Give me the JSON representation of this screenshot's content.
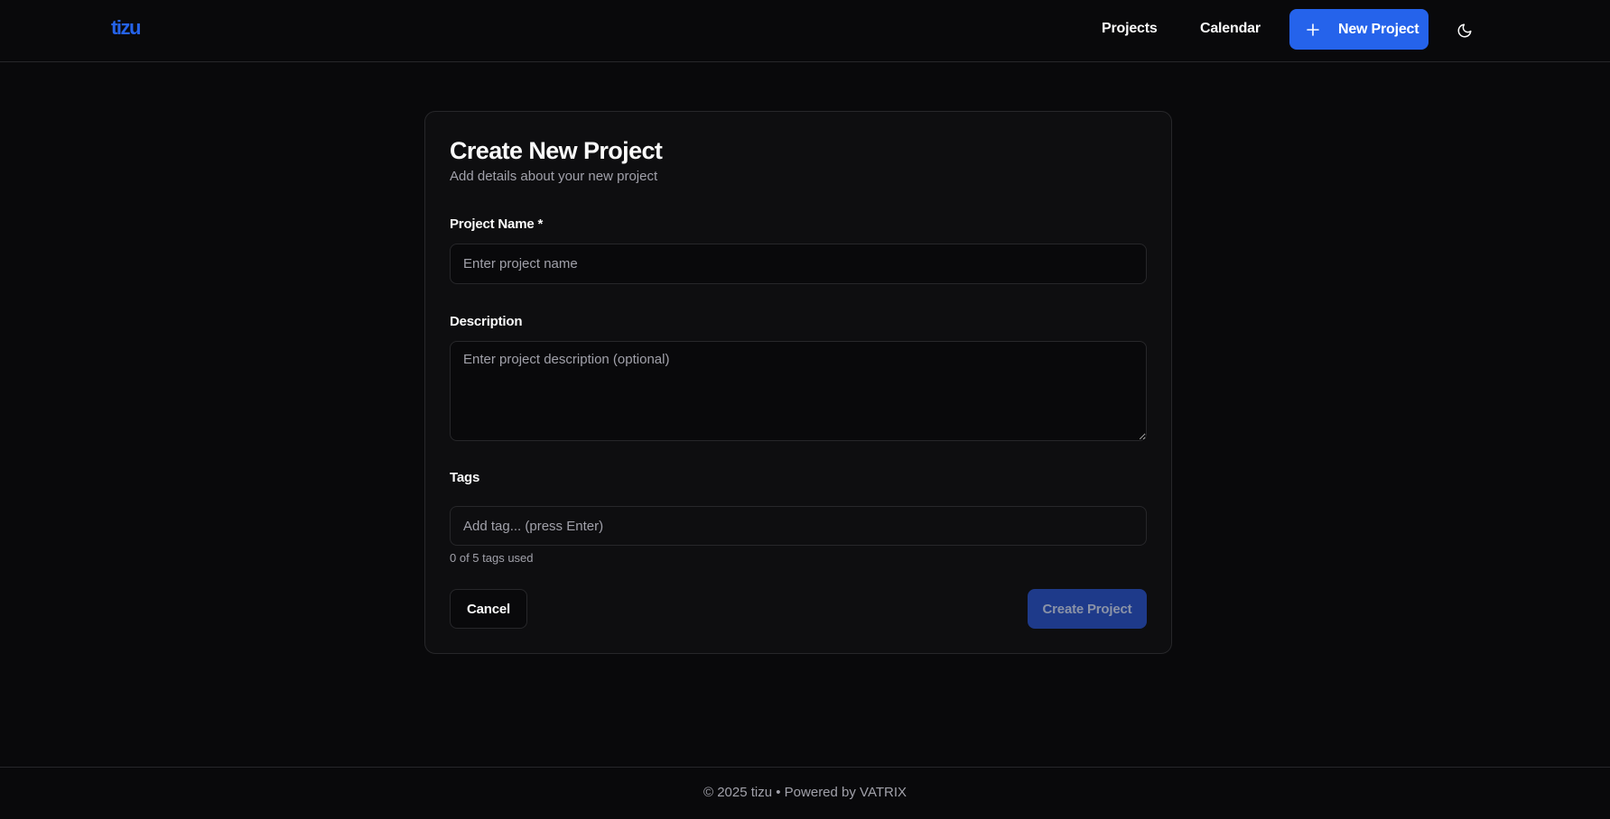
{
  "header": {
    "logo_text": "tizu",
    "nav": {
      "projects_label": "Projects",
      "calendar_label": "Calendar"
    },
    "new_project_label": "New Project",
    "theme_icon": "moon-icon",
    "brand_color": "#2563eb"
  },
  "form": {
    "title": "Create New Project",
    "subtitle": "Add details about your new project",
    "name": {
      "label": "Project Name *",
      "placeholder": "Enter project name",
      "value": ""
    },
    "description": {
      "label": "Description",
      "placeholder": "Enter project description (optional)",
      "value": ""
    },
    "tags": {
      "label": "Tags",
      "placeholder": "Add tag... (press Enter)",
      "count_text": "0 of 5 tags used"
    },
    "cancel_label": "Cancel",
    "submit_label": "Create Project"
  },
  "footer": {
    "text": "© 2025 tizu • Powered by VATRIX"
  }
}
